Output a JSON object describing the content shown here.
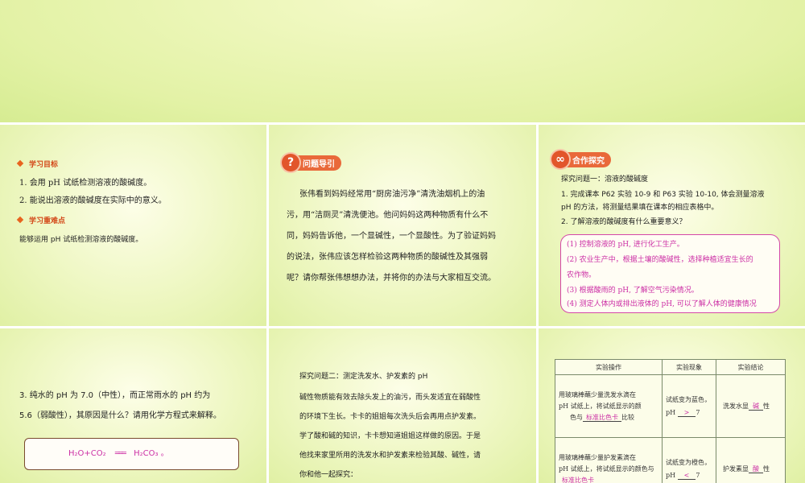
{
  "slide1": {
    "goal_heading": "学习目标",
    "goal_1": "1. 会用 pH 试纸检测溶液的酸碱度。",
    "goal_2": "2. 能说出溶液的酸碱度在实际中的意义。",
    "key_heading": "学习重难点",
    "key_text": "能够运用 pH 试纸检测溶液的酸碱度。"
  },
  "slide2": {
    "badge": "问题导引",
    "badge_icon": "question-icon",
    "lines": [
      "张伟看到妈妈经常用“厨房油污净”清洗油烟机上的油",
      "污，用“洁厕灵”清洗便池。他问妈妈这两种物质有什么不",
      "同，妈妈告诉他，一个显碱性，一个显酸性。为了验证妈妈",
      "的说法，张伟应该怎样检验这两种物质的酸碱性及其强弱",
      "呢？请你帮张伟想想办法，并将你的办法与大家相互交流。"
    ]
  },
  "slide3": {
    "badge": "合作探究",
    "badge_icon": "cooperation-icon",
    "q_title": "探究问题一：溶液的酸碱度",
    "q1_line1": "1. 完成课本 P62 实验 10-9 和 P63 实验 10-10, 体会测量溶液",
    "q1_line2": "pH 的方法，将测量结果填在课本的相应表格中。",
    "q2": "2. 了解溶液的酸碱度有什么重要意义？",
    "answers": [
      "(1) 控制溶液的 pH, 进行化工生产。",
      "(2) 农业生产中，根据土壤的酸碱性，选择种植适宜生长的",
      "农作物。",
      "(3) 根据酸雨的 pH, 了解空气污染情况。",
      "(4) 测定人体内或排出液体的 pH, 可以了解人体的健康情况"
    ]
  },
  "slide4": {
    "line1": "3. 纯水的 pH 为 7.0（中性），而正常雨水的 pH 约为",
    "line2": "5.6（弱酸性），其原因是什么？请用化学方程式来解释。",
    "eq_left": "H₂O+CO₂",
    "eq_arrow": "═══",
    "eq_right": "H₂CO₃ 。"
  },
  "slide5": {
    "title": "探究问题二：测定洗发水、护发素的 pH",
    "lines": [
      "碱性物质能有效去除头发上的油污，而头发适宜在弱酸性",
      "的环境下生长。卡卡的姐姐每次洗头后会再用点护发素。",
      "学了酸和碱的知识，卡卡想知道姐姐这样做的原因。于是",
      "他找来家里所用的洗发水和护发素来检验其酸、碱性，请",
      "你和他一起探究："
    ]
  },
  "slide6": {
    "headers": [
      "实验操作",
      "实验现象",
      "实验结论"
    ],
    "row1": {
      "op_lines": [
        "用玻璃棒蘸少量洗发水滴在",
        "pH 试纸上，将试纸显示的颜",
        "色与"
      ],
      "op_fill": "标准比色卡",
      "op_tail": "比较",
      "phen_line": "试纸变为蓝色，",
      "phen_ph": "pH",
      "phen_fill": ">",
      "phen_tail": "7",
      "conc_pre": "洗发水显",
      "conc_fill": "碱",
      "conc_post": "性"
    },
    "row2": {
      "op_lines": [
        "用玻璃棒蘸少量护发素滴在",
        "pH 试纸上，将试纸显示的颜色与"
      ],
      "op_fill": "标准比色卡",
      "phen_line": "试纸变为橙色，",
      "phen_ph": "pH",
      "phen_fill": "<",
      "phen_tail": "7",
      "conc_pre": "护发素显",
      "conc_fill": "酸",
      "conc_post": "性"
    }
  },
  "colors": {
    "accent_orange": "#e2552b",
    "pink": "#cc2fa5",
    "background": "#eef7c2"
  }
}
